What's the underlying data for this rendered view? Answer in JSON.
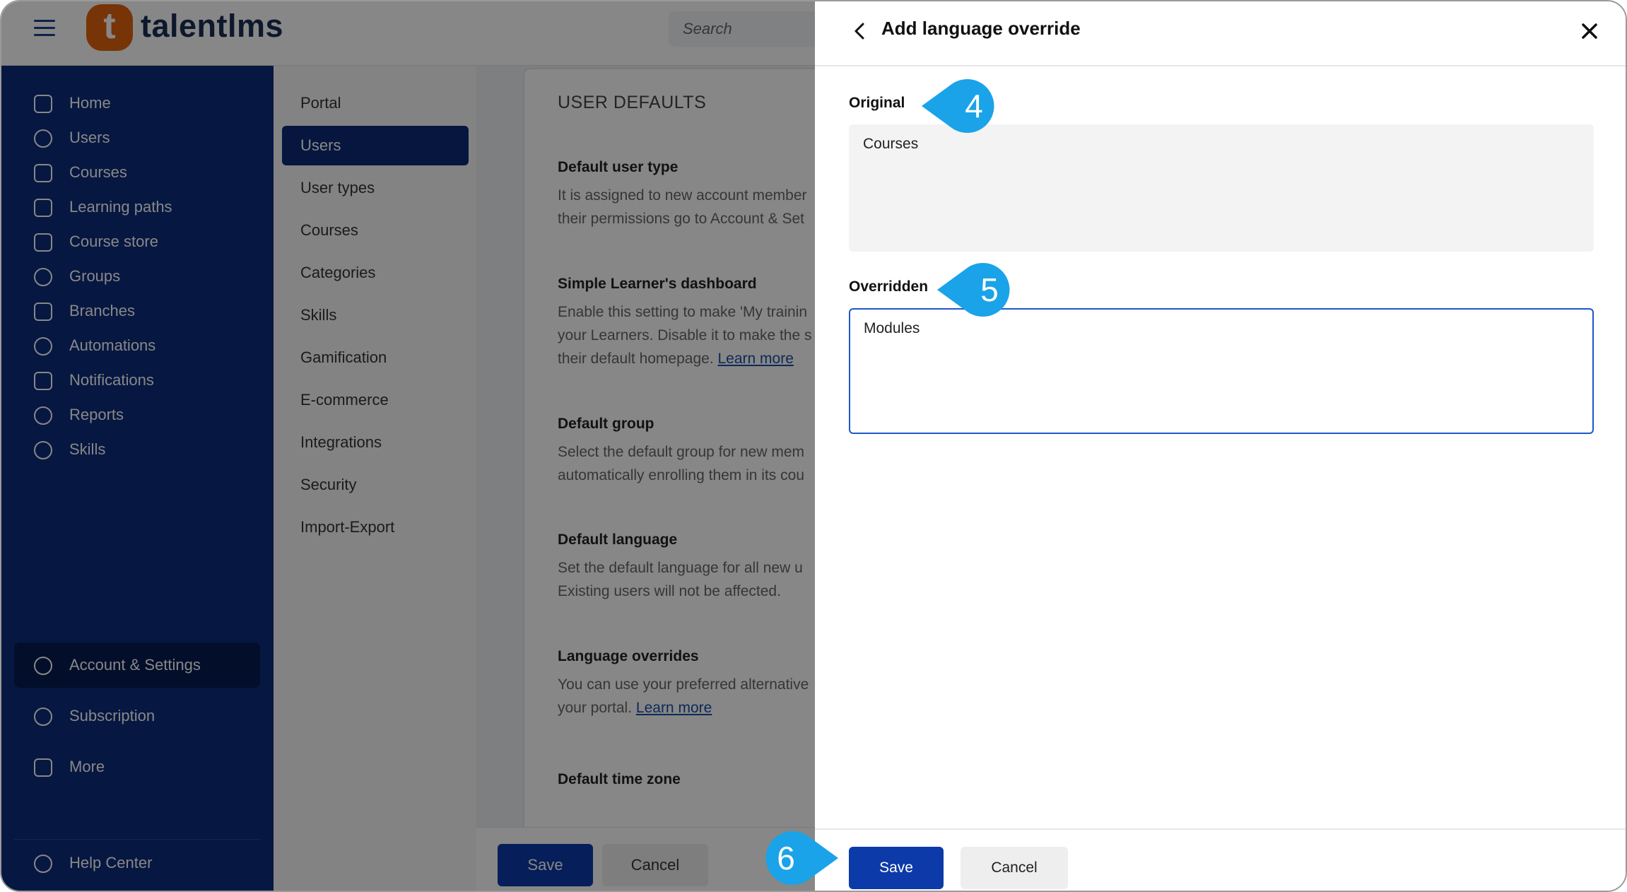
{
  "topbar": {
    "logo_letter": "t",
    "logo_text": "talentlms",
    "search_placeholder": "Search"
  },
  "sidebar": {
    "items": [
      {
        "label": "Home",
        "icon": "home-icon"
      },
      {
        "label": "Users",
        "icon": "user-icon"
      },
      {
        "label": "Courses",
        "icon": "book-icon"
      },
      {
        "label": "Learning paths",
        "icon": "path-icon"
      },
      {
        "label": "Course store",
        "icon": "store-icon"
      },
      {
        "label": "Groups",
        "icon": "groups-icon"
      },
      {
        "label": "Branches",
        "icon": "layers-icon"
      },
      {
        "label": "Automations",
        "icon": "automation-icon"
      },
      {
        "label": "Notifications",
        "icon": "megaphone-icon"
      },
      {
        "label": "Reports",
        "icon": "pie-chart-icon"
      },
      {
        "label": "Skills",
        "icon": "skills-icon"
      },
      {
        "label": "Account & Settings",
        "icon": "gear-icon",
        "active": true
      },
      {
        "label": "Subscription",
        "icon": "subscription-icon"
      },
      {
        "label": "More",
        "icon": "grid-icon"
      }
    ],
    "help_center": "Help Center"
  },
  "subnav": {
    "items": [
      "Portal",
      "Users",
      "User types",
      "Courses",
      "Categories",
      "Skills",
      "Gamification",
      "E-commerce",
      "Integrations",
      "Security",
      "Import-Export"
    ],
    "active_index": 1
  },
  "content": {
    "section_title": "USER DEFAULTS",
    "settings": [
      {
        "title": "Default user type",
        "desc_lines": [
          "It is assigned to new account member",
          "their permissions go to Account & Set"
        ],
        "link": ""
      },
      {
        "title": "Simple Learner's dashboard",
        "desc_lines": [
          "Enable this setting to make 'My trainin",
          "your Learners. Disable it to make the s",
          "their default homepage."
        ],
        "link": "Learn more"
      },
      {
        "title": "Default group",
        "desc_lines": [
          "Select the default group for new mem",
          "automatically enrolling them in its cou"
        ],
        "link": ""
      },
      {
        "title": "Default language",
        "desc_lines": [
          "Set the default language for all new u",
          "Existing users will not be affected."
        ],
        "link": ""
      },
      {
        "title": "Language overrides",
        "desc_lines": [
          "You can use your preferred alternative",
          "your portal."
        ],
        "link": "Learn more"
      },
      {
        "title": "Default time zone",
        "desc_lines": [],
        "link": ""
      }
    ],
    "save_label": "Save",
    "cancel_label": "Cancel"
  },
  "drawer": {
    "title": "Add language override",
    "original_label": "Original",
    "original_value": "Courses",
    "overridden_label": "Overridden",
    "overridden_value": "Modules",
    "save_label": "Save",
    "cancel_label": "Cancel"
  },
  "callouts": [
    "4",
    "5",
    "6"
  ],
  "colors": {
    "sidebar_bg": "#0d2c7c",
    "primary_button": "#0c3aa8",
    "logo_orange": "#e1620f",
    "callout_blue": "#1aa3e8",
    "input_focus_border": "#1d58c8"
  }
}
